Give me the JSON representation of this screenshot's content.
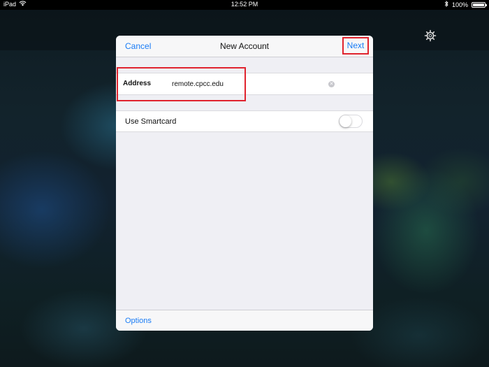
{
  "status_bar": {
    "device": "iPad",
    "time": "12:52 PM",
    "battery": "100%"
  },
  "dialog": {
    "cancel_label": "Cancel",
    "title": "New Account",
    "next_label": "Next",
    "address_label": "Address",
    "address_value": "remote.cpcc.edu",
    "smartcard_label": "Use Smartcard",
    "smartcard_enabled": false,
    "options_label": "Options"
  },
  "colors": {
    "accent": "#1a7cf5",
    "highlight": "#e0232e"
  },
  "icons": [
    "wifi-icon",
    "bluetooth-icon",
    "battery-icon",
    "gear-icon",
    "clear-text-icon"
  ]
}
